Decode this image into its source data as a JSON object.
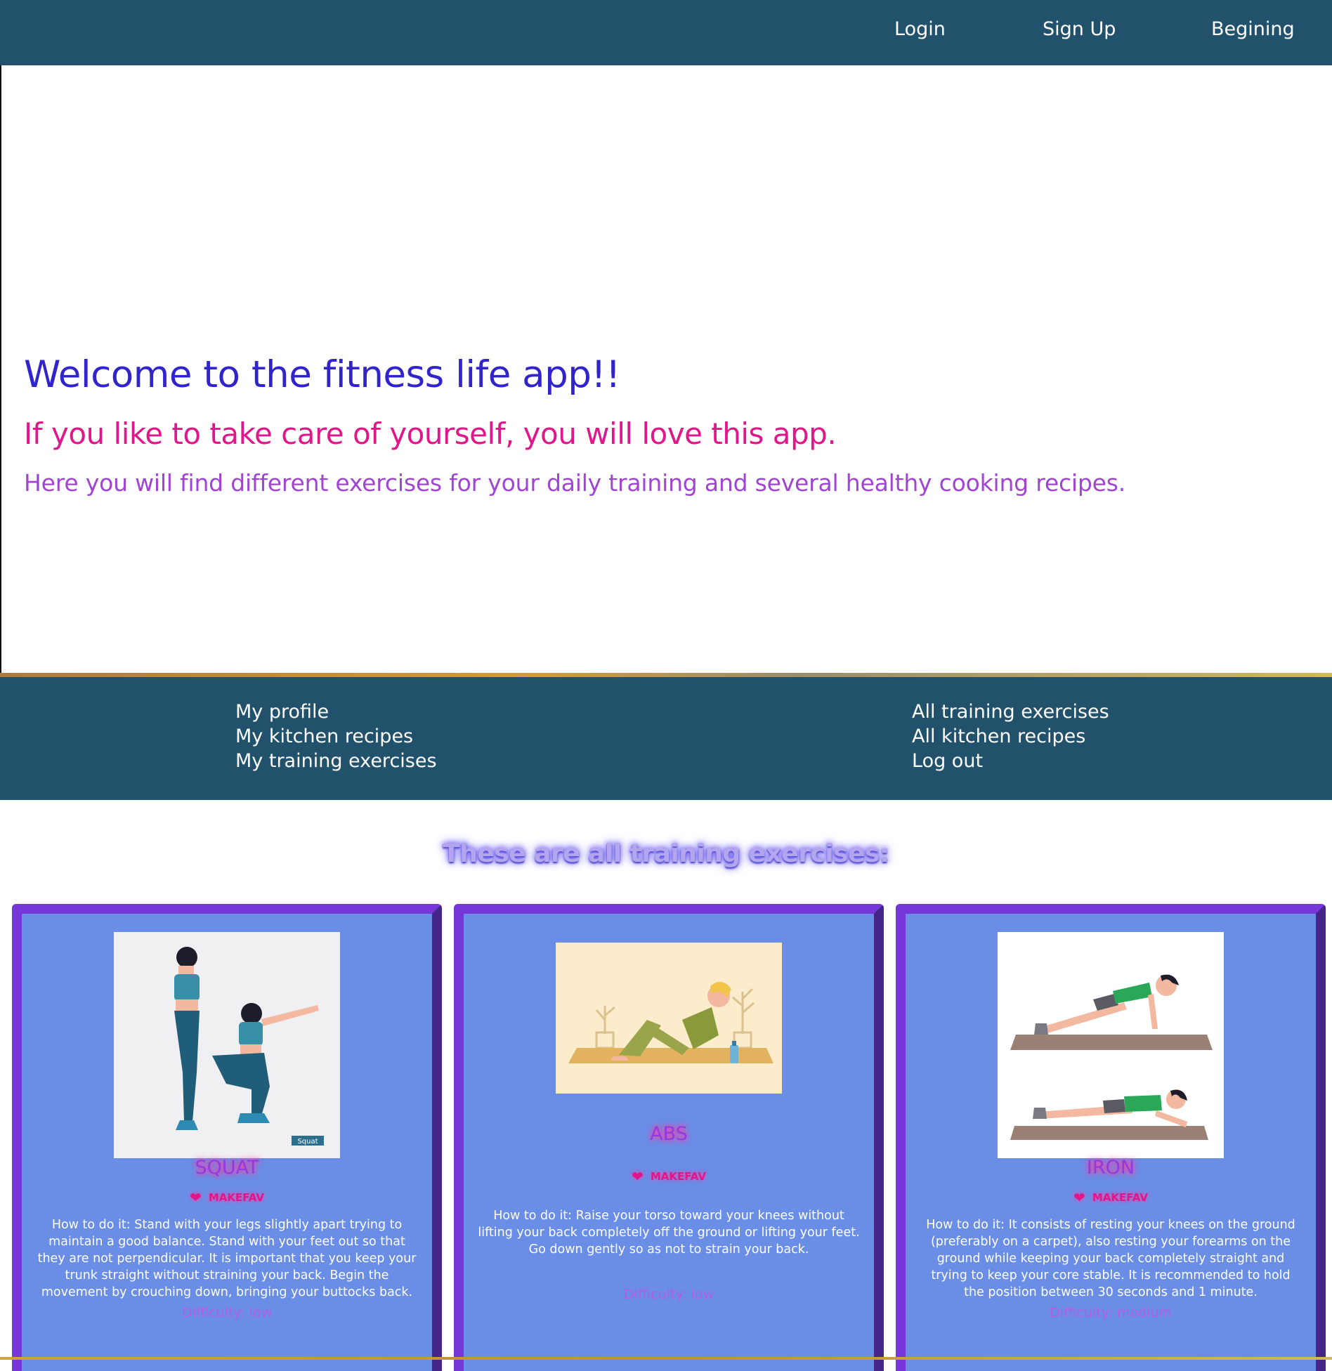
{
  "topnav": {
    "login": "Login",
    "signup": "Sign Up",
    "begining": "Begining"
  },
  "hero": {
    "title": "Welcome to the fitness life app!!",
    "subtitle": "If you like to take care of yourself, you will love this app.",
    "tagline": "Here you will find different exercises for your daily training and several healthy cooking recipes."
  },
  "membernav": {
    "left": [
      "My profile",
      "My kitchen recipes",
      "My training exercises"
    ],
    "right": [
      "All training exercises",
      "All kitchen recipes",
      "Log out"
    ]
  },
  "section_title": "These are all training exercises:",
  "fav_label": "MAKEFAV",
  "cards": [
    {
      "name": "SQUAT",
      "image_label": "Squat",
      "description": "How to do it: Stand with your legs slightly apart trying to maintain a good balance. Stand with your feet out so that they are not perpendicular. It is important that you keep your trunk straight without straining your back. Begin the movement by crouching down, bringing your buttocks back.",
      "difficulty": "Difficulty: low"
    },
    {
      "name": "ABS",
      "description": "How to do it: Raise your torso toward your knees without lifting your back completely off the ground or lifting your feet. Go down gently so as not to strain your back.",
      "difficulty": "Difficulty: low"
    },
    {
      "name": "IRON",
      "description": "How to do it: It consists of resting your knees on the ground (preferably on a carpet), also resting your forearms on the ground while keeping your back completely straight and trying to keep your core stable. It is recommended to hold the position between 30 seconds and 1 minute.",
      "difficulty": "Difficulty: medium"
    }
  ],
  "colors": {
    "nav_bg": "#22526b",
    "card_bg": "#6a8de6",
    "card_border": "#7637d8",
    "title_blue": "#3124cc",
    "subtitle_pink": "#e0168b",
    "tagline_purple": "#a144d4"
  }
}
